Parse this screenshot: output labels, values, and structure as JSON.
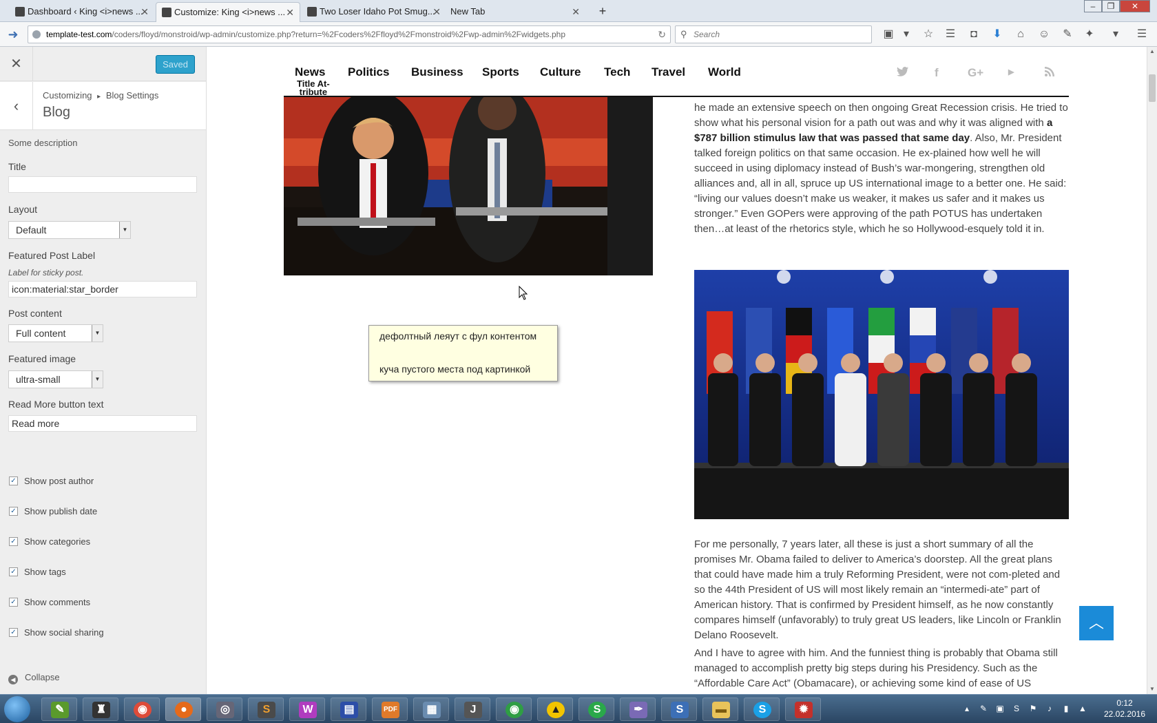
{
  "browser": {
    "tabs": [
      {
        "label": "Dashboard ‹ King <i>news ...",
        "active": false
      },
      {
        "label": "Customize: King <i>news ...",
        "active": true
      },
      {
        "label": "Two Loser Idaho Pot Smug...",
        "active": false
      },
      {
        "label": "New Tab",
        "active": false
      }
    ],
    "url_host": "template-test.com",
    "url_path": "/coders/floyd/monstroid/wp-admin/customize.php?return=%2Fcoders%2Ffloyd%2Fmonstroid%2Fwp-admin%2Fwidgets.php",
    "search_placeholder": "Search"
  },
  "customizer": {
    "save_label": "Saved",
    "breadcrumb_root": "Customizing",
    "breadcrumb_sep": "▸",
    "breadcrumb_section": "Blog Settings",
    "section_title": "Blog",
    "description": "Some description",
    "title_label": "Title",
    "title_value": "",
    "layout_label": "Layout",
    "layout_value": "Default",
    "featured_label": "Featured Post Label",
    "featured_desc": "Label for sticky post.",
    "featured_value": "icon:material:star_border",
    "post_content_label": "Post content",
    "post_content_value": "Full content",
    "featured_image_label": "Featured image",
    "featured_image_value": "ultra-small",
    "readmore_label": "Read More button text",
    "readmore_value": "Read more",
    "checkboxes": [
      {
        "label": "Show post author",
        "checked": true
      },
      {
        "label": "Show publish date",
        "checked": true
      },
      {
        "label": "Show categories",
        "checked": true
      },
      {
        "label": "Show tags",
        "checked": true
      },
      {
        "label": "Show comments",
        "checked": true
      },
      {
        "label": "Show social sharing",
        "checked": true
      }
    ],
    "collapse_label": "Collapse"
  },
  "preview": {
    "menu": [
      "News",
      "Politics",
      "Business",
      "Sports",
      "Culture",
      "Tech",
      "Travel",
      "World"
    ],
    "title_attribute": "Title At-tribute",
    "title_attribute_line1": "Title At-",
    "title_attribute_line2": "tribute",
    "social_icons": [
      "twitter-icon",
      "facebook-icon",
      "google-plus-icon",
      "youtube-icon",
      "rss-icon"
    ],
    "paragraph1_a": "he made an extensive speech on then ongoing Great Recession crisis. He tried to show what his personal vision for a path out was and why it was aligned with ",
    "paragraph1_bold": "a $787 billion stimulus law that was passed that same day",
    "paragraph1_b": ". Also, Mr. President talked foreign politics on that same occasion. He ex-plained how well he will succeed in using diplomacy instead of Bush’s war-mongering, strengthen old alliances and, all in all, spruce up US international image to a better one. He said: “living our values doesn’t make us weaker, it makes us safer and it makes us stronger.” Even GOPers were approving of the path POTUS has undertaken then…at least of the rhetorics style, which he so Hollywood-esquely told it in.",
    "paragraph2": "For me personally, 7 years later, all these is just a short summary of all the promises Mr. Obama failed to deliver to America’s doorstep. All the great plans that could have made him a truly Reforming President, were not com-pleted and so the 44th President of US will most likely remain an “intermedi-ate” part of American history. That is confirmed by President himself, as he now constantly compares himself (unfavorably) to truly great US leaders, like Lincoln or Franklin Delano Roosevelt.",
    "paragraph3": "And I have to agree with him. And the funniest thing is probably that Obama still managed to accomplish pretty big steps during his Presidency. Such as the “Affordable Care Act” (Obamacare), or achieving some kind of ease of US",
    "tooltip_line1": "дефолтный леяут с фул контентом",
    "tooltip_line2": "куча пустого места под картинкой"
  },
  "taskbar": {
    "time": "0:12",
    "date": "22.02.2016"
  }
}
